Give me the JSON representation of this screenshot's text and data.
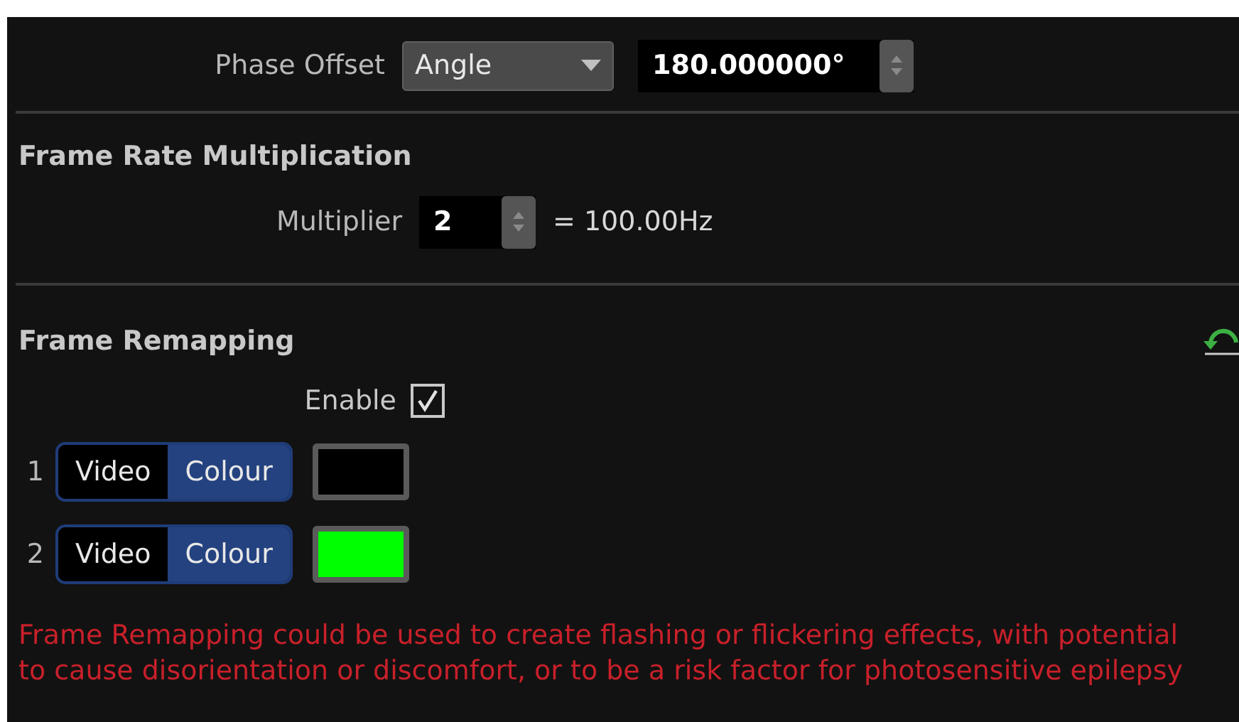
{
  "phase_offset": {
    "label": "Phase Offset",
    "mode": "Angle",
    "value": "180.000000°"
  },
  "frame_rate_multiplication": {
    "title": "Frame Rate Multiplication",
    "label": "Multiplier",
    "value": "2",
    "result": "= 100.00Hz"
  },
  "frame_remapping": {
    "title": "Frame Remapping",
    "enable_label": "Enable",
    "enabled": true,
    "slots": [
      {
        "index": "1",
        "options": [
          {
            "label": "Video",
            "selected": false
          },
          {
            "label": "Colour",
            "selected": true
          }
        ],
        "color": "#000000"
      },
      {
        "index": "2",
        "options": [
          {
            "label": "Video",
            "selected": false
          },
          {
            "label": "Colour",
            "selected": true
          }
        ],
        "color": "#00ff00"
      }
    ],
    "warning": "Frame Remapping could be used to create flashing or flickering effects, with potential to cause disorientation or discomfort, or to be a risk factor for photosensitive epilepsy"
  }
}
